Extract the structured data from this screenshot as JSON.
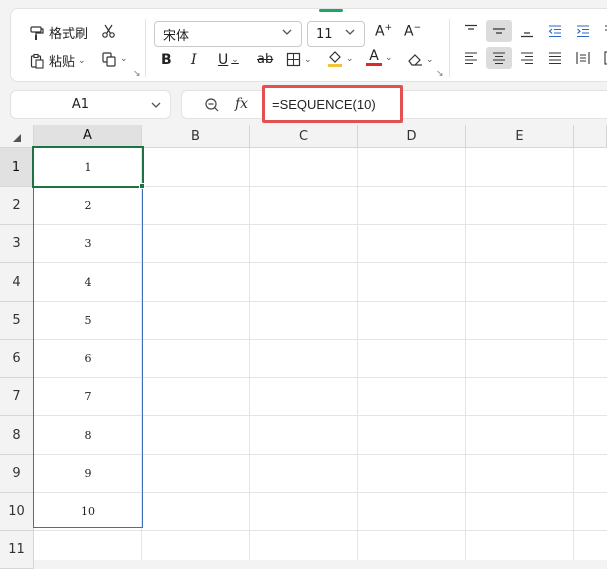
{
  "ribbon": {
    "format_painter": "格式刷",
    "paste": "粘贴",
    "font_name": "宋体",
    "font_size": "11",
    "bold": "B",
    "italic": "I",
    "underline": "U",
    "strike": "ab",
    "font_color_letter": "A",
    "grow_font": "A⁺",
    "shrink_font": "A⁻",
    "font_color": "#d92b2b",
    "fill_color": "#f3c33b"
  },
  "formula_bar": {
    "name_box": "A1",
    "fx": "fx",
    "formula": "=SEQUENCE(10)"
  },
  "sheet": {
    "columns": [
      "A",
      "B",
      "C",
      "D",
      "E"
    ],
    "rows": [
      "1",
      "2",
      "3",
      "4",
      "5",
      "6",
      "7",
      "8",
      "9",
      "10",
      "11"
    ],
    "col_a_values": [
      "1",
      "2",
      "3",
      "4",
      "5",
      "6",
      "7",
      "8",
      "9",
      "10"
    ]
  }
}
